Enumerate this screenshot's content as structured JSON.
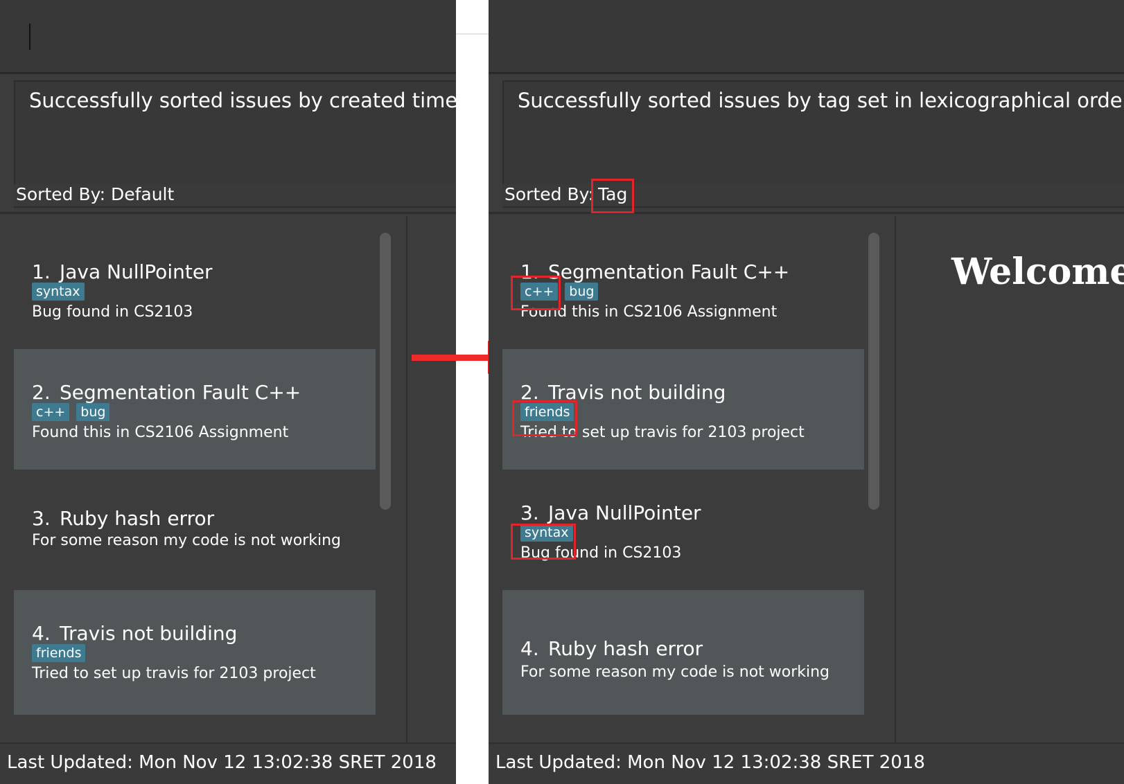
{
  "left": {
    "command_input": "",
    "result_message": "Successfully sorted issues by created time.",
    "sorted_by_label": "Sorted By:",
    "sorted_by_value": "Default",
    "issues": [
      {
        "number": "1.",
        "title": "Java NullPointer",
        "tags": [
          "syntax"
        ],
        "description": "Bug found in CS2103"
      },
      {
        "number": "2.",
        "title": "Segmentation Fault C++",
        "tags": [
          "c++",
          "bug"
        ],
        "description": "Found this in CS2106 Assignment"
      },
      {
        "number": "3.",
        "title": "Ruby hash error",
        "tags": [],
        "description": "For some reason my code is not working"
      },
      {
        "number": "4.",
        "title": "Travis not building",
        "tags": [
          "friends"
        ],
        "description": "Tried to set up travis for 2103 project"
      }
    ],
    "status": "Last Updated: Mon Nov 12 13:02:38 SRET 2018"
  },
  "right": {
    "command_input": "",
    "result_message": "Successfully sorted issues by tag set in lexicographical order.",
    "sorted_by_label": "Sorted By:",
    "sorted_by_value": "Tag",
    "issues": [
      {
        "number": "1.",
        "title": "Segmentation Fault C++",
        "tags": [
          "c++",
          "bug"
        ],
        "description": "Found this in CS2106 Assignment"
      },
      {
        "number": "2.",
        "title": "Travis not building",
        "tags": [
          "friends"
        ],
        "description": "Tried to set up travis for 2103 project"
      },
      {
        "number": "3.",
        "title": "Java NullPointer",
        "tags": [
          "syntax"
        ],
        "description": "Bug found in CS2103"
      },
      {
        "number": "4.",
        "title": "Ruby hash error",
        "tags": [],
        "description": "For some reason my code is not working"
      }
    ],
    "browser_text": "Welcome t",
    "status": "Last Updated: Mon Nov 12 13:02:38 SRET 2018"
  },
  "colors": {
    "background": "#3c3c3c",
    "card_alt": "#515658",
    "tag": "#3e7b91",
    "highlight": "#e0262a",
    "arrow": "#ee2b2b"
  },
  "icons": {
    "transition": "right-arrow-icon"
  }
}
